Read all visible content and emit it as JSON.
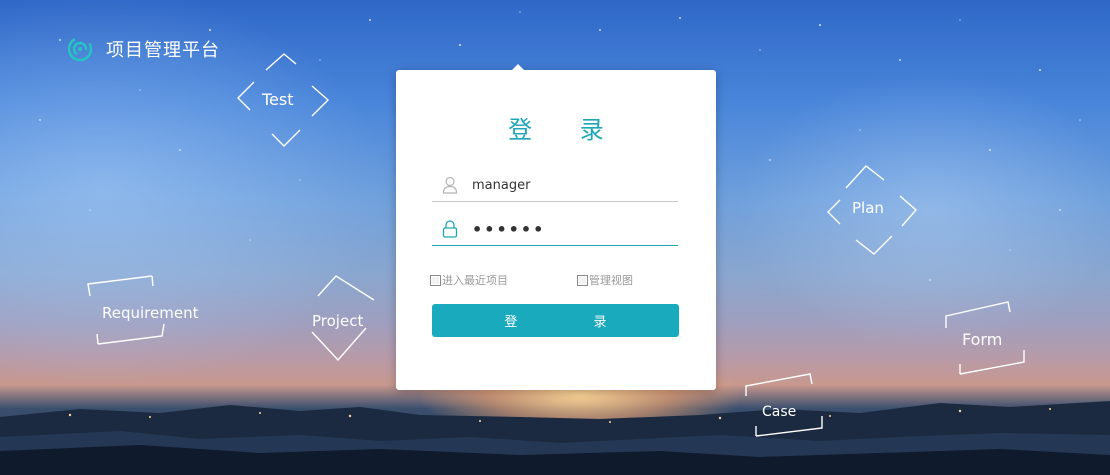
{
  "brand": {
    "name": "项目管理平台",
    "logo_icon": "spiral-logo-icon"
  },
  "login": {
    "title": "登 录",
    "username_value": "manager",
    "password_value": "••••••",
    "user_icon": "user-icon",
    "lock_icon": "lock-icon",
    "options": [
      {
        "label": "进入最近项目",
        "checked": false
      },
      {
        "label": "管理视图",
        "checked": false
      }
    ],
    "submit_label": "登 录"
  },
  "decorations": {
    "test": "Test",
    "plan": "Plan",
    "requirement": "Requirement",
    "project": "Project",
    "form": "Form",
    "case": "Case"
  },
  "colors": {
    "accent": "#1aaabd",
    "title": "#1fa7b7",
    "card_bg": "#ffffff"
  }
}
